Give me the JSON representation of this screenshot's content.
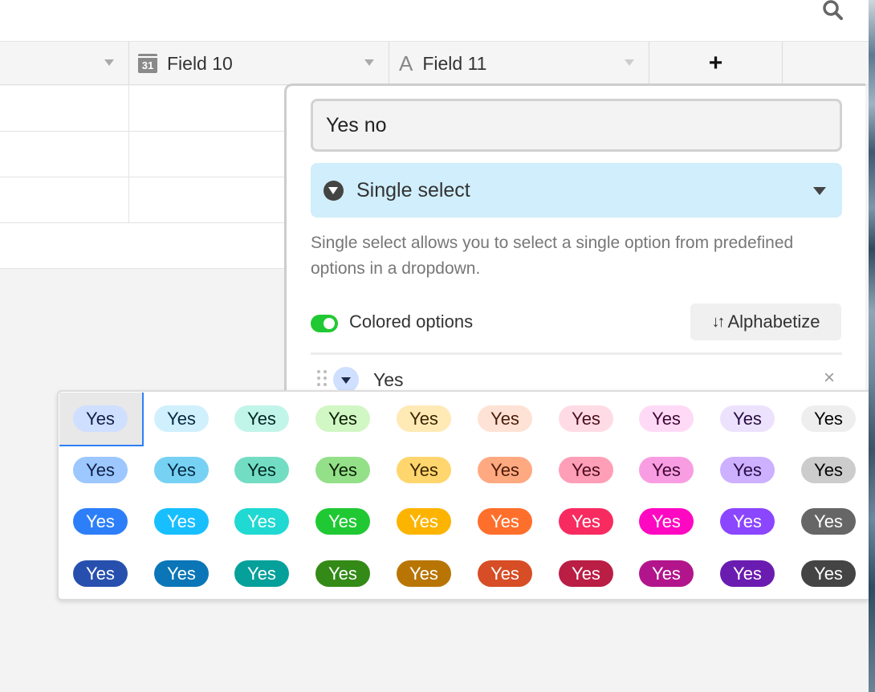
{
  "columns": [
    {
      "name": "",
      "type": "hidden"
    },
    {
      "name": "Field 10",
      "icon": "calendar-icon",
      "icon_text": "31"
    },
    {
      "name": "Field 11",
      "icon": "text-icon",
      "icon_text": "A"
    },
    {
      "name": "+",
      "icon": "plus-icon"
    }
  ],
  "field_editor": {
    "field_name": "Yes no",
    "field_type": "Single select",
    "description": "Single select allows you to select a single option from predefined options in a dropdown.",
    "colored_options_label": "Colored options",
    "colored_options_enabled": true,
    "alphabetize_label": "Alphabetize",
    "option": {
      "label": "Yes",
      "color": "#cfdfff"
    },
    "remove_glyph": "×"
  },
  "palette": {
    "chip_label": "Yes",
    "selected": {
      "row": 0,
      "col": 0
    },
    "rows": [
      {
        "bg": [
          "#cfdfff",
          "#d0f0fd",
          "#c2f5e9",
          "#d1f7c4",
          "#ffeab6",
          "#fee2d5",
          "#ffdce5",
          "#ffdaf6",
          "#ede2fe",
          "#eeeeee"
        ],
        "fg": [
          "#102046",
          "#04283f",
          "#012524",
          "#0b1d05",
          "#3b2501",
          "#4b1b07",
          "#4c0c1c",
          "#400832",
          "#280b42",
          "#040404"
        ]
      },
      {
        "bg": [
          "#9cc7ff",
          "#77d1f3",
          "#72ddc3",
          "#93e088",
          "#ffd66e",
          "#ffa981",
          "#ff9eb7",
          "#f99de2",
          "#cdb0ff",
          "#cccccc"
        ],
        "fg": [
          "#102046",
          "#04283f",
          "#012524",
          "#0b1d05",
          "#3b2501",
          "#4b1b07",
          "#4c0c1c",
          "#400832",
          "#280b42",
          "#040404"
        ]
      },
      {
        "bg": [
          "#2d7ff9",
          "#18bfff",
          "#20d9d2",
          "#20c933",
          "#fcb400",
          "#ff6f2c",
          "#f82b60",
          "#ff08c2",
          "#8b46ff",
          "#666666"
        ],
        "fg": [
          "#ffffff",
          "#ffffff",
          "#ffffff",
          "#ffffff",
          "#ffffff",
          "#ffffff",
          "#ffffff",
          "#ffffff",
          "#ffffff",
          "#ffffff"
        ]
      },
      {
        "bg": [
          "#2750ae",
          "#0b76b7",
          "#06a09b",
          "#338a17",
          "#b87503",
          "#d74d26",
          "#ba1e45",
          "#b2158b",
          "#6b1cb0",
          "#444444"
        ],
        "fg": [
          "#ffffff",
          "#ffffff",
          "#ffffff",
          "#ffffff",
          "#ffffff",
          "#ffffff",
          "#ffffff",
          "#ffffff",
          "#ffffff",
          "#ffffff"
        ]
      }
    ]
  }
}
